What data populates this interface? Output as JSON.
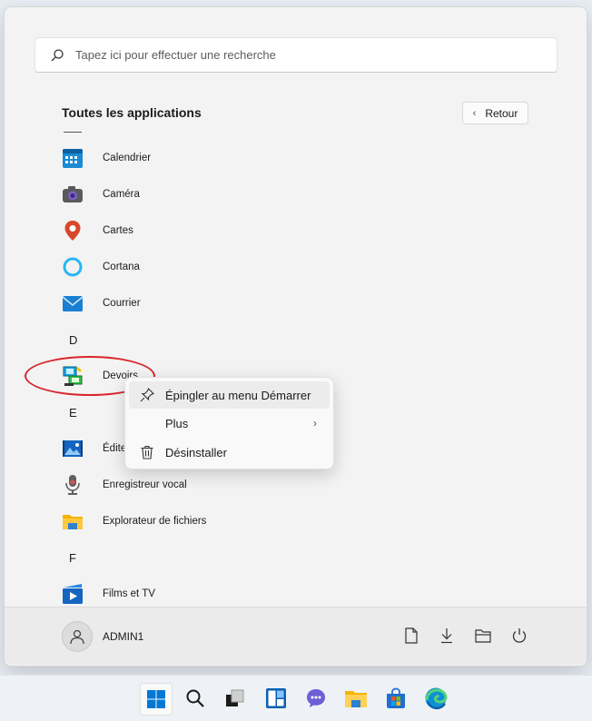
{
  "search": {
    "placeholder": "Tapez ici pour effectuer une recherche",
    "icon": "search-icon"
  },
  "header": {
    "title": "Toutes les applications",
    "back_label": "Retour"
  },
  "apps": [
    {
      "label": "Calendrier",
      "icon": "calendar-icon"
    },
    {
      "label": "Caméra",
      "icon": "camera-icon"
    },
    {
      "label": "Cartes",
      "icon": "maps-pin-icon"
    },
    {
      "label": "Cortana",
      "icon": "cortana-ring-icon"
    },
    {
      "label": "Courrier",
      "icon": "mail-icon"
    },
    {
      "label": "Devoirs",
      "icon": "homework-app-icon"
    },
    {
      "label": "Édite",
      "icon": "video-editor-icon"
    },
    {
      "label": "Enregistreur vocal",
      "icon": "microphone-icon"
    },
    {
      "label": "Explorateur de fichiers",
      "icon": "folder-icon"
    },
    {
      "label": "Films et TV",
      "icon": "films-tv-icon"
    }
  ],
  "letters": [
    "D",
    "E",
    "F"
  ],
  "context_menu": {
    "items": [
      {
        "label": "Épingler au menu Démarrer",
        "icon": "pin-icon"
      },
      {
        "label": "Plus",
        "icon": "",
        "arrow": "›"
      },
      {
        "label": "Désinstaller",
        "icon": "trash-icon"
      }
    ]
  },
  "footer": {
    "user": "ADMIN1",
    "buttons": [
      "documents-icon",
      "downloads-icon",
      "file-explorer-icon",
      "power-icon"
    ]
  },
  "taskbar": {
    "items": [
      "start-icon",
      "search-icon",
      "task-view-icon",
      "widgets-icon",
      "chat-icon",
      "file-explorer-icon",
      "store-icon",
      "edge-icon"
    ]
  },
  "colors": {
    "accent": "#0067c0",
    "annotation": "#d9262b",
    "panel": "#f3f3f3"
  }
}
